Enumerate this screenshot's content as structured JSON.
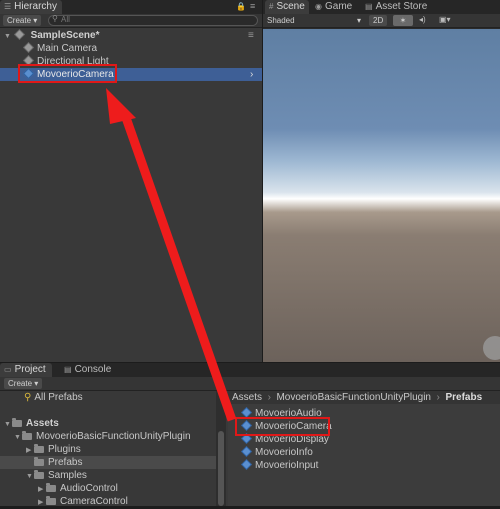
{
  "hierarchy": {
    "tab": "Hierarchy",
    "create": "Create",
    "search_placeholder": "All",
    "scene": "SampleScene*",
    "items": [
      "Main Camera",
      "Directional Light",
      "MovoerioCamera"
    ]
  },
  "scene_tabs": {
    "scene": "Scene",
    "game": "Game",
    "asset_store": "Asset Store"
  },
  "scene_toolbar": {
    "shading": "Shaded",
    "mode_2d": "2D"
  },
  "project": {
    "tab": "Project",
    "console_tab": "Console",
    "create": "Create",
    "favorites": [
      "All Prefabs"
    ],
    "tree": {
      "assets": "Assets",
      "plugin": "MovoerioBasicFunctionUnityPlugin",
      "plugins": "Plugins",
      "prefabs": "Prefabs",
      "samples": "Samples",
      "audio": "AudioControl",
      "camera": "CameraControl"
    },
    "breadcrumb": [
      "Assets",
      "MovoerioBasicFunctionUnityPlugin",
      "Prefabs"
    ],
    "assets": [
      "MovoerioAudio",
      "MovoerioCamera",
      "MovoerioDisplay",
      "MovoerioInfo",
      "MovoerioInput"
    ]
  },
  "colors": {
    "highlight": "#e01818",
    "selection": "#3e5f96",
    "arrow": "#ee1c1c"
  }
}
